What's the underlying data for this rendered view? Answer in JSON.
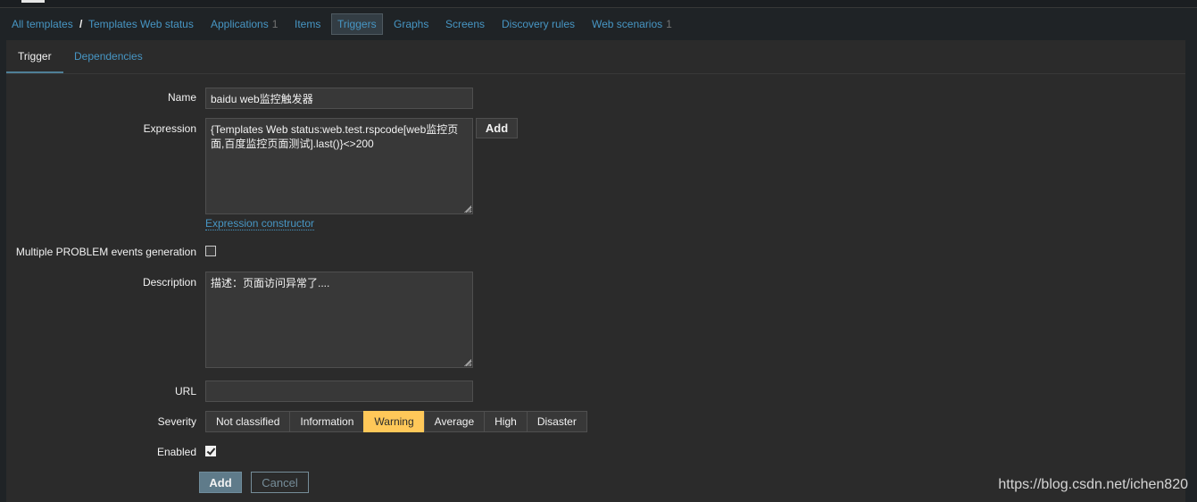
{
  "breadcrumbs": {
    "all_templates": "All templates",
    "separator": "/",
    "template_name": "Templates Web status",
    "applications": {
      "label": "Applications",
      "count": "1"
    },
    "items": "Items",
    "triggers": "Triggers",
    "graphs": "Graphs",
    "screens": "Screens",
    "discovery_rules": "Discovery rules",
    "web_scenarios": {
      "label": "Web scenarios",
      "count": "1"
    }
  },
  "tabs": {
    "trigger": "Trigger",
    "dependencies": "Dependencies"
  },
  "form": {
    "name_label": "Name",
    "name_value": "baidu web监控触发器",
    "expression_label": "Expression",
    "expression_value": "{Templates Web status:web.test.rspcode[web监控页面,百度监控页面测试].last()}<>200",
    "expression_add": "Add",
    "expression_constructor": "Expression constructor",
    "multiple_problem_label": "Multiple PROBLEM events generation",
    "multiple_problem_checked": false,
    "description_label": "Description",
    "description_value": "描述：页面访问异常了....",
    "url_label": "URL",
    "url_value": "",
    "severity_label": "Severity",
    "severity_options": [
      "Not classified",
      "Information",
      "Warning",
      "Average",
      "High",
      "Disaster"
    ],
    "severity_selected": "Warning",
    "enabled_label": "Enabled",
    "enabled_checked": true
  },
  "actions": {
    "add": "Add",
    "cancel": "Cancel"
  },
  "watermark": "https://blog.csdn.net/ichen820",
  "colors": {
    "background": "#2b2b2b",
    "link": "#4796c4",
    "severity_warning": "#ffc859",
    "primary_button": "#5f7b8a"
  }
}
